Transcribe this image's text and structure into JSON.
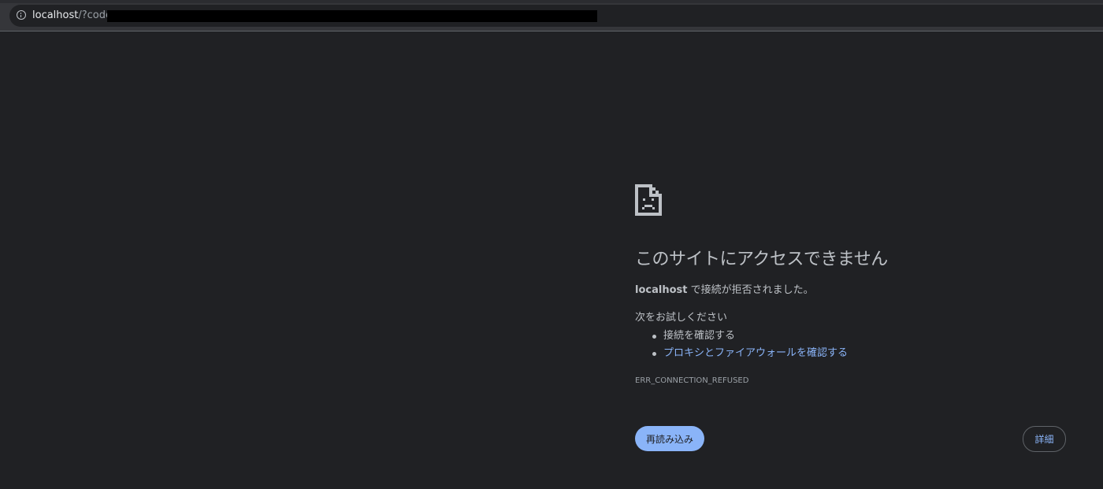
{
  "browser": {
    "url_host": "localhost",
    "url_path": "/?code="
  },
  "error_page": {
    "icon": "sad-page-icon",
    "title": "このサイトにアクセスできません",
    "host": "localhost",
    "message": " で接続が拒否されました。",
    "try_label": "次をお試しください",
    "suggestions": [
      {
        "label": "接続を確認する",
        "link": false
      },
      {
        "label": "プロキシとファイアウォールを確認する",
        "link": true
      }
    ],
    "error_code": "ERR_CONNECTION_REFUSED",
    "reload_label": "再読み込み",
    "details_label": "詳細"
  },
  "colors": {
    "background": "#202124",
    "text": "#bdc1c6",
    "link": "#8ab4f8",
    "button": "#8ab4f8"
  }
}
